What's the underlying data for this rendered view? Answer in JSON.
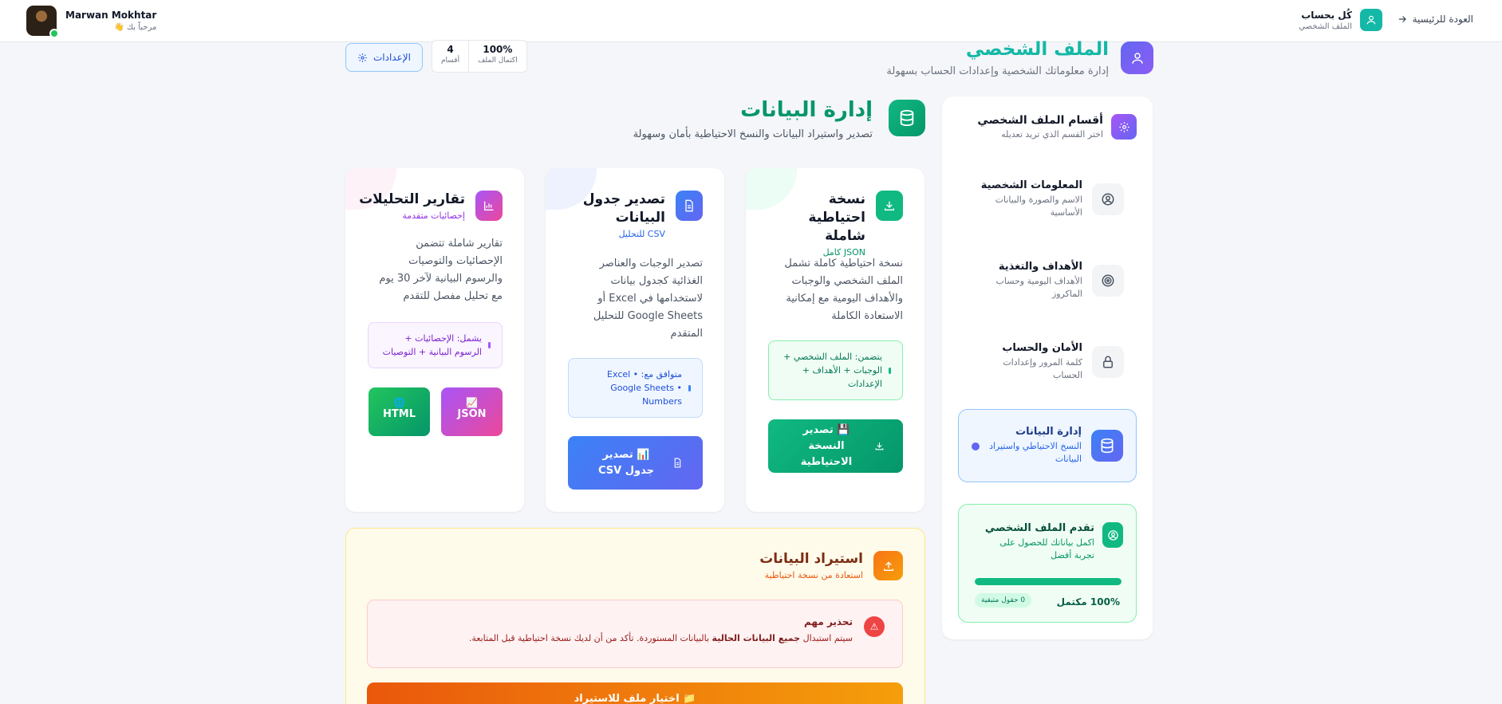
{
  "topbar": {
    "user_name": "Marwan Mokhtar",
    "greeting": "مرحباً بك 👋",
    "brand_title": "كُل بحساب",
    "brand_sub": "الملف الشخصي",
    "back_label": "العودة للرئيسية"
  },
  "page": {
    "title": "الملف الشخصي",
    "subtitle": "إدارة معلوماتك الشخصية وإعدادات الحساب بسهولة",
    "settings_label": "الإعدادات",
    "stats": [
      {
        "value": "100%",
        "label": "اكتمال الملف"
      },
      {
        "value": "4",
        "label": "أقسام"
      }
    ]
  },
  "sidebar": {
    "title": "أقسام الملف الشخصي",
    "subtitle": "اختر القسم الذي تريد تعديله",
    "items": [
      {
        "title": "المعلومات الشخصية",
        "desc": "الاسم والصورة والبيانات الأساسية",
        "icon": "user-circle-icon"
      },
      {
        "title": "الأهداف والتغذية",
        "desc": "الأهداف اليومية وحساب الماكروز",
        "icon": "target-icon"
      },
      {
        "title": "الأمان والحساب",
        "desc": "كلمة المرور وإعدادات الحساب",
        "icon": "lock-icon"
      },
      {
        "title": "إدارة البيانات",
        "desc": "النسخ الاحتياطي واستيراد البيانات",
        "icon": "database-icon"
      }
    ],
    "active_index": 3,
    "progress": {
      "title": "تقدم الملف الشخصي",
      "desc": "اكمل بياناتك للحصول على تجربة أفضل",
      "percent_label": "100% مكتمل",
      "percent": 100,
      "chip": "0 حقول متبقية"
    }
  },
  "data_management": {
    "title": "إدارة البيانات",
    "subtitle": "تصدير واستيراد البيانات والنسخ الاحتياطية بأمان وسهولة"
  },
  "cards": {
    "backup": {
      "title": "نسخة احتياطية شاملة",
      "tag": "JSON كامل",
      "desc": "نسخة احتياطية كاملة تشمل الملف الشخصي والوجبات والأهداف اليومية مع إمكانية الاستعادة الكاملة",
      "note": "يتضمن: الملف الشخصي + الوجبات + الأهداف + الإعدادات",
      "button": "💾 تصدير النسخة الاحتياطية",
      "accent": "#10b981"
    },
    "csv": {
      "title": "تصدير جدول البيانات",
      "tag": "CSV للتحليل",
      "desc": "تصدير الوجبات والعناصر الغذائية كجدول بيانات لاستخدامها في Excel أو Google Sheets للتحليل المتقدم",
      "note": "متوافق مع: Excel • Google Sheets • Numbers",
      "button": "📊 تصدير جدول CSV",
      "accent": "#3b82f6"
    },
    "reports": {
      "title": "تقارير التحليلات",
      "tag": "إحصائيات متقدمة",
      "desc": "تقارير شاملة تتضمن الإحصائيات والتوصيات والرسوم البيانية لآخر 30 يوم مع تحليل مفصل للتقدم",
      "note": "يشمل: الإحصائيات + الرسوم البيانية + التوصيات",
      "json_label": "JSON",
      "html_label": "HTML",
      "accent": "#a855f7"
    }
  },
  "import": {
    "title": "استيراد البيانات",
    "subtitle": "استعادة من نسخة احتياطية",
    "warning_title": "تحذير مهم",
    "warning_pre": "سيتم استبدال ",
    "warning_bold": "جميع البيانات الحالية",
    "warning_post": " بالبيانات المستوردة. تأكد من أن لديك نسخة احتياطية قبل المتابعة.",
    "button": "📁 اختيار ملف للاستيراد"
  }
}
